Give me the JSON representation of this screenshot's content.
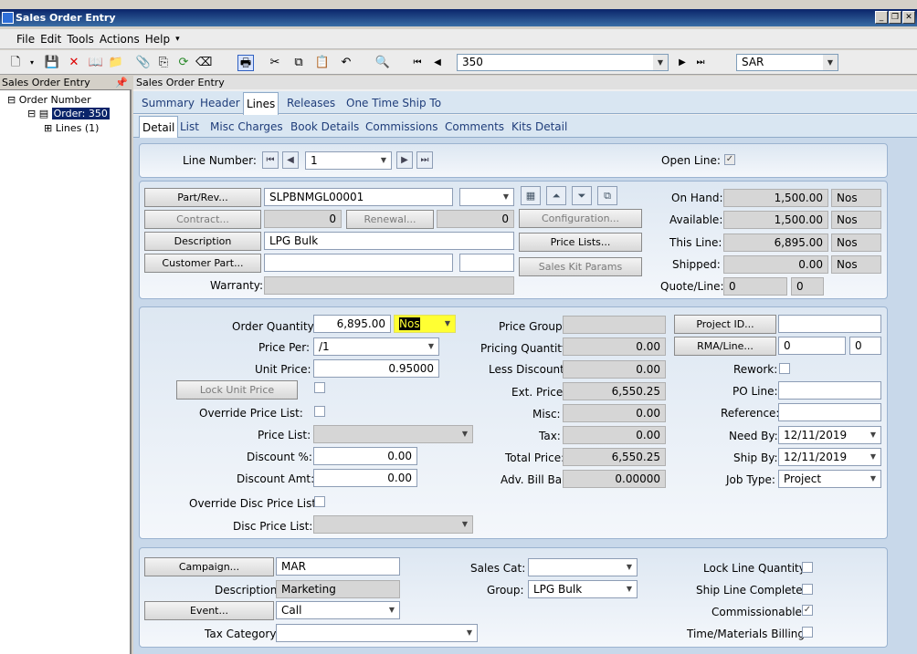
{
  "window": {
    "title": "Sales Order Entry"
  },
  "menu": [
    "File",
    "Edit",
    "Tools",
    "Actions",
    "Help"
  ],
  "toolbar": {
    "order_combo": "350",
    "company_combo": "SAR"
  },
  "left_panel": {
    "title": "Sales Order Entry",
    "tree": {
      "root": "Order Number",
      "order": "Order: 350",
      "lines": "Lines (1)"
    }
  },
  "right_title": "Sales Order Entry",
  "tabs_primary": [
    "Summary",
    "Header",
    "Lines",
    "Releases",
    "One Time Ship To"
  ],
  "tabs_secondary": [
    "Detail",
    "List",
    "Misc Charges",
    "Book Details",
    "Commissions",
    "Comments",
    "Kits Detail"
  ],
  "line_nav": {
    "label": "Line Number:",
    "value": "1",
    "open_line_label": "Open Line:"
  },
  "part_section": {
    "part_rev_btn": "Part/Rev...",
    "part_value": "SLPBNMGL00001",
    "contract_btn": "Contract...",
    "contract_value": "0",
    "renewal_btn": "Renewal...",
    "renewal_value": "0",
    "description_btn": "Description",
    "description_value": "LPG Bulk",
    "customer_part_btn": "Customer Part...",
    "warranty_label": "Warranty:",
    "configuration_btn": "Configuration...",
    "price_lists_btn": "Price Lists...",
    "sales_kit_btn": "Sales Kit Params",
    "on_hand_label": "On Hand:",
    "on_hand": "1,500.00",
    "on_hand_uom": "Nos",
    "available_label": "Available:",
    "available": "1,500.00",
    "available_uom": "Nos",
    "this_line_label": "This Line:",
    "this_line": "6,895.00",
    "this_line_uom": "Nos",
    "shipped_label": "Shipped:",
    "shipped": "0.00",
    "shipped_uom": "Nos",
    "quote_line_label": "Quote/Line:",
    "quote_value": "0",
    "quote_line_value": "0"
  },
  "price_section": {
    "order_qty_label": "Order Quantity:",
    "order_qty": "6,895.00",
    "order_uom": "Nos",
    "price_per_label": "Price Per:",
    "price_per": "/1",
    "unit_price_label": "Unit Price:",
    "unit_price": "0.95000",
    "lock_unit_price_btn": "Lock Unit Price",
    "override_price_list_label": "Override Price List:",
    "price_list_label": "Price List:",
    "discount_pct_label": "Discount %:",
    "discount_pct": "0.00",
    "discount_amt_label": "Discount Amt:",
    "discount_amt": "0.00",
    "override_disc_label": "Override Disc Price List:",
    "disc_price_list_label": "Disc Price List:",
    "price_group_label": "Price Group:",
    "pricing_qty_label": "Pricing Quantity:",
    "pricing_qty": "0.00",
    "less_discount_label": "Less Discount:",
    "less_discount": "0.00",
    "ext_price_label": "Ext. Price:",
    "ext_price": "6,550.25",
    "misc_label": "Misc:",
    "misc": "0.00",
    "tax_label": "Tax:",
    "tax": "0.00",
    "total_price_label": "Total Price:",
    "total_price": "6,550.25",
    "adv_bill_label": "Adv. Bill Bal:",
    "adv_bill": "0.00000",
    "project_id_btn": "Project ID...",
    "rma_line_btn": "RMA/Line...",
    "rma_value": "0",
    "rma_line_value": "0",
    "rework_label": "Rework:",
    "po_line_label": "PO Line:",
    "reference_label": "Reference:",
    "need_by_label": "Need By:",
    "need_by": "12/11/2019",
    "ship_by_label": "Ship By:",
    "ship_by": "12/11/2019",
    "job_type_label": "Job Type:",
    "job_type": "Project"
  },
  "campaign_section": {
    "campaign_btn": "Campaign...",
    "campaign": "MAR",
    "description_label": "Description:",
    "description": "Marketing",
    "event_btn": "Event...",
    "event": "Call",
    "tax_category_label": "Tax Category:",
    "sales_cat_label": "Sales Cat:",
    "group_label": "Group:",
    "group": "LPG Bulk",
    "lock_line_qty_label": "Lock Line Quantity:",
    "ship_line_complete_label": "Ship Line Complete:",
    "commissionable_label": "Commissionable:",
    "time_materials_label": "Time/Materials Billing:"
  }
}
